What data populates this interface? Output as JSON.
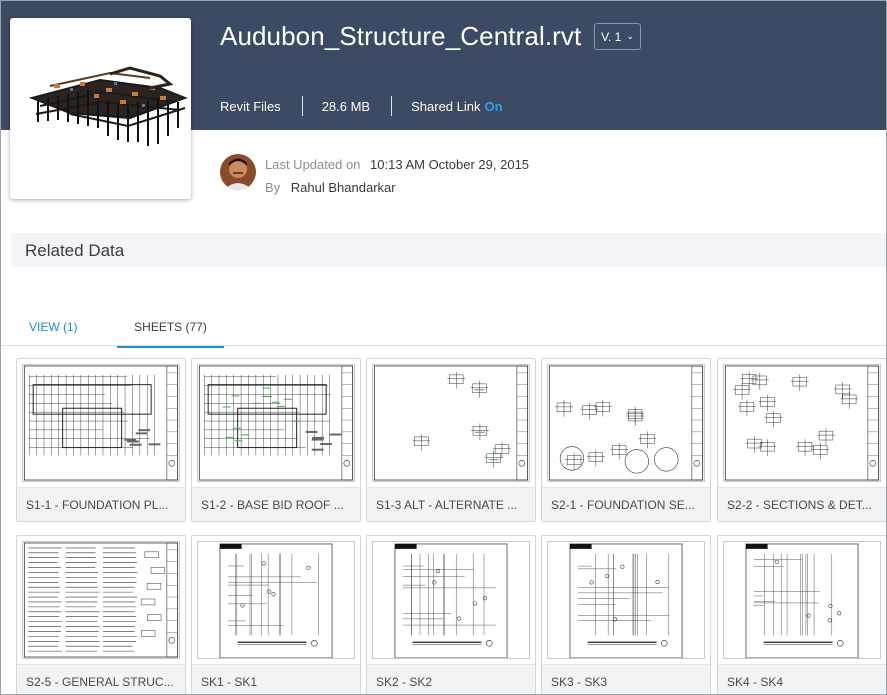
{
  "file": {
    "name": "Audubon_Structure_Central.rvt",
    "version_label": "V. 1",
    "type": "Revit Files",
    "size": "28.6 MB",
    "shared_link_label": "Shared Link",
    "shared_link_state": "On"
  },
  "updated": {
    "label": "Last Updated on",
    "value": "10:13 AM October 29, 2015",
    "by_label": "By",
    "by_value": "Rahul Bhandarkar"
  },
  "related": {
    "title": "Related Data"
  },
  "tabs": [
    {
      "label": "VIEW (1)"
    },
    {
      "label": "SHEETS (77)"
    }
  ],
  "sheets": [
    {
      "caption": "S1-1 - FOUNDATION PL...",
      "kind": "plan"
    },
    {
      "caption": "S1-2 - BASE BID ROOF ...",
      "kind": "plan-green"
    },
    {
      "caption": "S1-3 ALT - ALTERNATE ...",
      "kind": "details-sparse"
    },
    {
      "caption": "S2-1 - FOUNDATION SE...",
      "kind": "sections"
    },
    {
      "caption": "S2-2 - SECTIONS & DET...",
      "kind": "details"
    },
    {
      "caption": "S2-5 - GENERAL STRUC...",
      "kind": "notes"
    },
    {
      "caption": "SK1 - SK1",
      "kind": "sketch"
    },
    {
      "caption": "SK2 - SK2",
      "kind": "sketch"
    },
    {
      "caption": "SK3 - SK3",
      "kind": "sketch"
    },
    {
      "caption": "SK4 - SK4",
      "kind": "sketch"
    }
  ],
  "colors": {
    "header_bg": "#3d4a63",
    "accent": "#1d8ed6",
    "shared_on": "#2ea3e6"
  },
  "icons": [
    "chevron-down-icon",
    "user-avatar"
  ]
}
